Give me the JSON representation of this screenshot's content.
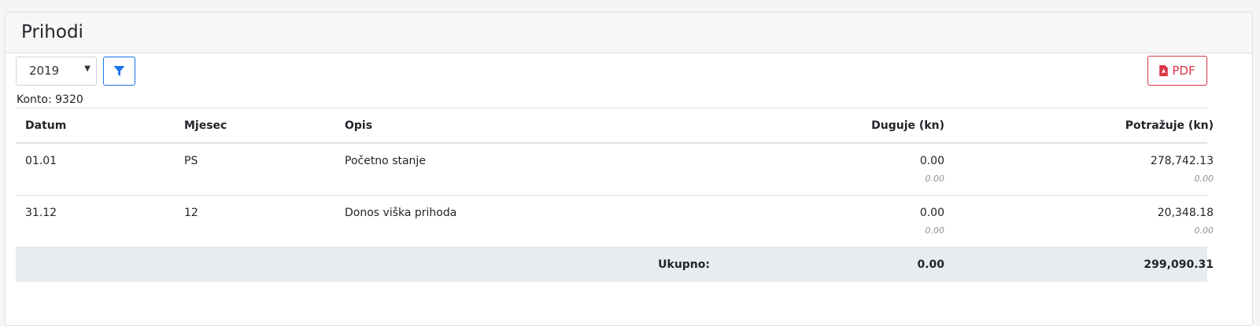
{
  "page": {
    "title": "Prihodi"
  },
  "filters": {
    "year_selected": "2019",
    "pdf_label": "PDF"
  },
  "konto_label": "Konto: 9320",
  "table": {
    "headers": {
      "datum": "Datum",
      "mjesec": "Mjesec",
      "opis": "Opis",
      "duguje": "Duguje (kn)",
      "potrazuje": "Potražuje (kn)"
    },
    "rows": [
      {
        "datum": "01.01",
        "mjesec": "PS",
        "opis": "Početno stanje",
        "duguje": "0.00",
        "duguje_sub": "0.00",
        "potrazuje": "278,742.13",
        "potrazuje_sub": "0.00"
      },
      {
        "datum": "31.12",
        "mjesec": "12",
        "opis": "Donos viška prihoda",
        "duguje": "0.00",
        "duguje_sub": "0.00",
        "potrazuje": "20,348.18",
        "potrazuje_sub": "0.00"
      }
    ],
    "total": {
      "label": "Ukupno:",
      "duguje": "0.00",
      "potrazuje": "299,090.31"
    }
  },
  "icons": {
    "filter": "filter-icon",
    "pdf": "file-pdf-icon"
  },
  "colors": {
    "primary": "#1a73e8",
    "danger": "#dc3545",
    "total_bg": "#e9ecef"
  }
}
